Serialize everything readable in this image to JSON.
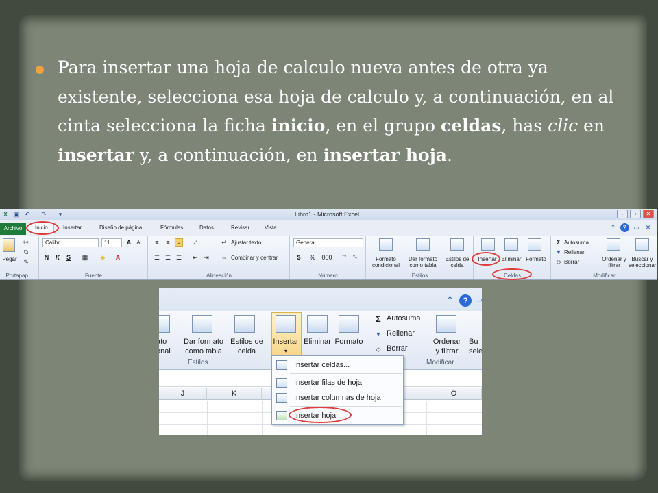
{
  "slide": {
    "bullet": {
      "p1": "Para insertar una hoja de calculo nueva antes de otra ya existente, selecciona esa hoja de calculo y, a continuación, en al cinta selecciona la ficha ",
      "b1": "inicio",
      "p2": ", en el grupo ",
      "b2": "celdas",
      "p3": ", has ",
      "i1": "clic",
      "p4": "  en ",
      "b3": "insertar",
      "p5": " y, a continuación, en ",
      "b4": "insertar hoja",
      "p6": "."
    }
  },
  "ribbon": {
    "title": "Libro1  -  Microsoft Excel",
    "tabs": [
      "Archivo",
      "Inicio",
      "Insertar",
      "Diseño de página",
      "Fórmulas",
      "Datos",
      "Revisar",
      "Vista"
    ],
    "clipboard": {
      "paste": "Pegar",
      "label": "Portapap..."
    },
    "font": {
      "name": "Calibri",
      "size": "11",
      "label": "Fuente",
      "bold": "N",
      "italic": "K",
      "underline": "S"
    },
    "alignment": {
      "wrap": "Ajustar texto",
      "merge": "Combinar y centrar",
      "label": "Alineación"
    },
    "number": {
      "format": "General",
      "currency": "$",
      "percent": "%",
      "thousands": "000",
      "label": "Número"
    },
    "styles": {
      "conditional": "Formato condicional",
      "table": "Dar formato como tabla",
      "cell": "Estilos de celda",
      "label": "Estilos"
    },
    "cells": {
      "insert": "Insertar",
      "delete": "Eliminar",
      "format": "Formato",
      "label": "Celdas"
    },
    "editing": {
      "autosum": "Autosuma",
      "fill": "Rellenar",
      "clear": "Borrar",
      "sort": "Ordenar y filtrar",
      "find": "Buscar y seleccionar",
      "label": "Modificar"
    }
  },
  "zoom": {
    "styles": {
      "conditional_partial": "ato\nonal",
      "table": "Dar formato\ncomo tabla",
      "cell": "Estilos de\ncelda",
      "label": "Estilos"
    },
    "cells": {
      "insert": "Insertar",
      "delete": "Eliminar",
      "format": "Formato"
    },
    "editing": {
      "autosum": "Autosuma",
      "fill": "Rellenar",
      "clear": "Borrar",
      "sort": "Ordenar\ny filtrar",
      "find_partial": "Bu\nsele",
      "label": "Modificar"
    },
    "columns": [
      "J",
      "K",
      "O"
    ],
    "menu": {
      "insert_cells": "Insertar celdas...",
      "insert_rows": "Insertar filas de hoja",
      "insert_cols": "Insertar columnas de hoja",
      "insert_sheet": "Insertar hoja"
    }
  },
  "colors": {
    "accent_red": "#e03a3a",
    "bullet": "#f2a23a",
    "file_tab": "#1f7b3a"
  }
}
